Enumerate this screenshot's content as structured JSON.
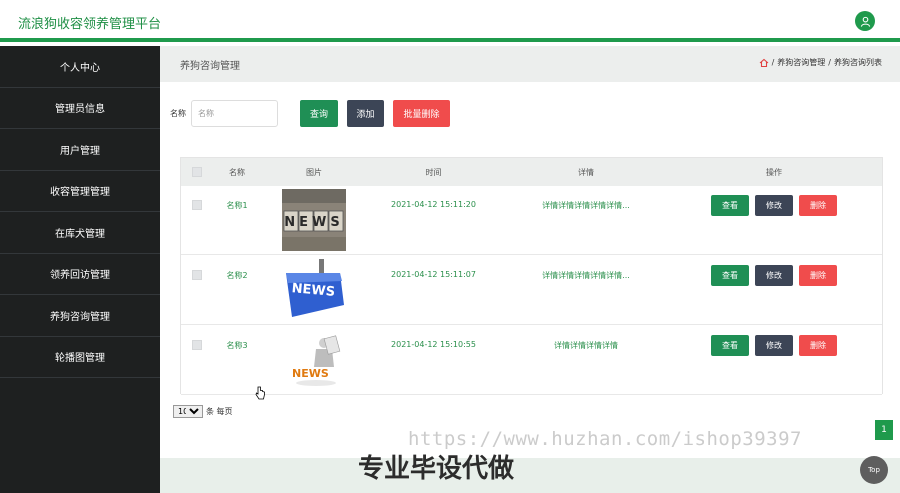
{
  "app": {
    "title": "流浪狗收容领养管理平台"
  },
  "sidebar": {
    "items": [
      {
        "label": "个人中心"
      },
      {
        "label": "管理员信息"
      },
      {
        "label": "用户管理"
      },
      {
        "label": "收容管理管理"
      },
      {
        "label": "在库犬管理"
      },
      {
        "label": "领养回访管理"
      },
      {
        "label": "养狗咨询管理"
      },
      {
        "label": "轮播图管理"
      }
    ]
  },
  "page": {
    "title": "养狗咨询管理",
    "breadcrumb": [
      "养狗咨询管理",
      "养狗咨询列表"
    ],
    "breadcrumb_sep": "/"
  },
  "search": {
    "label": "名称",
    "placeholder": "名称",
    "query_label": "查询",
    "add_label": "添加",
    "batch_delete_label": "批量删除"
  },
  "table": {
    "headers": {
      "name": "名称",
      "image": "图片",
      "time": "时间",
      "detail": "详情",
      "actions": "操作"
    },
    "rows": [
      {
        "name": "名称1",
        "image": "NEWS",
        "time": "2021-04-12 15:11:20",
        "detail": "详情详情详情详情详情..."
      },
      {
        "name": "名称2",
        "image": "NEWS",
        "time": "2021-04-12 15:11:07",
        "detail": "详情详情详情详情详情..."
      },
      {
        "name": "名称3",
        "image": "NEWS",
        "time": "2021-04-12 15:10:55",
        "detail": "详情详情详情详情"
      }
    ],
    "action_labels": {
      "view": "查看",
      "edit": "修改",
      "delete": "删除"
    }
  },
  "pagination": {
    "page_size": "10",
    "page_size_suffix": "条 每页",
    "current_page": "1"
  },
  "overlay": {
    "url_watermark": "https://www.huzhan.com/ishop39397",
    "cn_watermark": "专业毕设代做",
    "top_label": "Top"
  },
  "colors": {
    "brand": "#1f9a4c",
    "sidebar": "#1e2020",
    "danger": "#f04c4c",
    "dark": "#3c4556"
  }
}
